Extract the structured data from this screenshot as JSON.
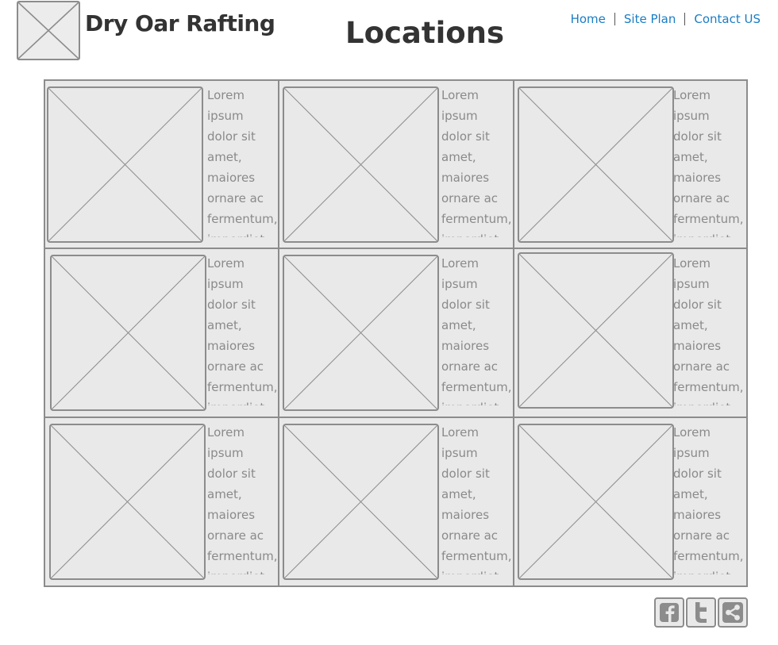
{
  "header": {
    "site_name": "Dry Oar Rafting",
    "page_title": "Locations"
  },
  "nav": {
    "items": [
      {
        "label": "Home"
      },
      {
        "label": "Site Plan"
      },
      {
        "label": "Contact US"
      }
    ]
  },
  "locations": [
    {
      "text": "Lorem ipsum\ndolor sit\namet,\nmaiores\nornare ac\nfermentum,\nimperdiet ut\nvivamus a"
    },
    {
      "text": "Lorem ipsum\ndolor sit\namet,\nmaiores\nornare ac\nfermentum,\nimperdiet ut\nvivamus a"
    },
    {
      "text": "Lorem ipsum\ndolor sit\namet,\nmaiores\nornare ac\nfermentum,\nimperdiet ut\nvivamus a"
    },
    {
      "text": "Lorem ipsum\ndolor sit\namet,\nmaiores\nornare ac\nfermentum,\nimperdiet ut\nvivamus a"
    },
    {
      "text": "Lorem ipsum\ndolor sit\namet,\nmaiores\nornare ac\nfermentum,\nimperdiet ut\nvivamus a"
    },
    {
      "text": "Lorem ipsum\ndolor sit\namet,\nmaiores\nornare ac\nfermentum,\nimperdiet ut\nvivamus a"
    },
    {
      "text": "Lorem ipsum\ndolor sit\namet,\nmaiores\nornare ac\nfermentum,\nimperdiet ut\nvivamus a"
    },
    {
      "text": "Lorem ipsum\ndolor sit\namet,\nmaiores\nornare ac\nfermentum,\nimperdiet ut\nvivamus a"
    },
    {
      "text": "Lorem ipsum\ndolor sit\namet,\nmaiores\nornare ac\nfermentum,\nimperdiet ut\nvivamus a"
    }
  ],
  "social": [
    {
      "icon": "facebook-icon"
    },
    {
      "icon": "twitter-icon"
    },
    {
      "icon": "share-icon"
    }
  ],
  "colors": {
    "link": "#1a7dc4",
    "heading": "#333333",
    "placeholder_border": "#8c8c8c",
    "placeholder_fill": "#e9e9e9",
    "body_text": "#8a8a8a"
  }
}
